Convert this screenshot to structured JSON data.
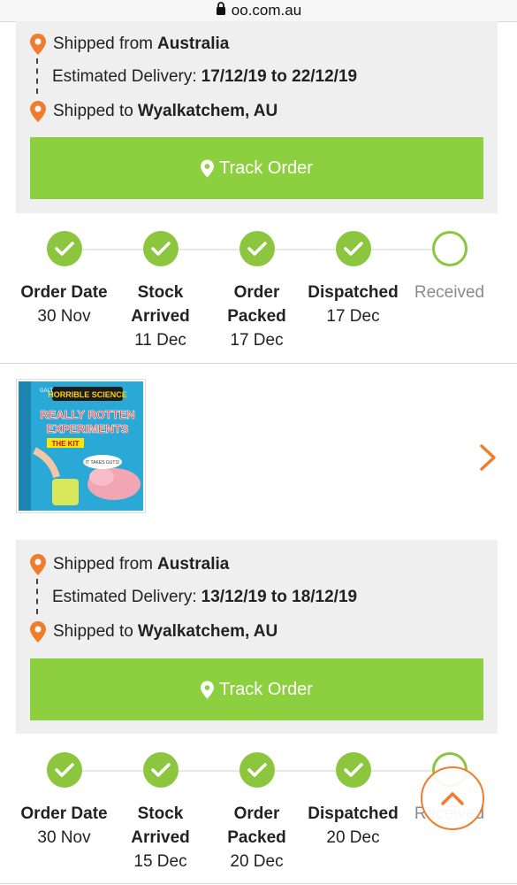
{
  "browser": {
    "url": "oo.com.au"
  },
  "orders": [
    {
      "shipped_from_label": "Shipped from",
      "shipped_from": "Australia",
      "delivery_label": "Estimated Delivery:",
      "delivery_range": "17/12/19 to 22/12/19",
      "shipped_to_label": "Shipped to",
      "shipped_to": "Wyalkatchem, AU",
      "track_label": "Track Order",
      "steps": [
        {
          "name": "Order Date",
          "date": "30 Nov",
          "done": true
        },
        {
          "name": "Stock Arrived",
          "date": "11 Dec",
          "done": true
        },
        {
          "name": "Order Packed",
          "date": "17 Dec",
          "done": true
        },
        {
          "name": "Dispatched",
          "date": "17 Dec",
          "done": true
        },
        {
          "name": "Received",
          "date": "",
          "done": false
        }
      ]
    },
    {
      "shipped_from_label": "Shipped from",
      "shipped_from": "Australia",
      "delivery_label": "Estimated Delivery:",
      "delivery_range": "13/12/19 to 18/12/19",
      "shipped_to_label": "Shipped to",
      "shipped_to": "Wyalkatchem, AU",
      "track_label": "Track Order",
      "steps": [
        {
          "name": "Order Date",
          "date": "30 Nov",
          "done": true
        },
        {
          "name": "Stock Arrived",
          "date": "15 Dec",
          "done": true
        },
        {
          "name": "Order Packed",
          "date": "20 Dec",
          "done": true
        },
        {
          "name": "Dispatched",
          "date": "20 Dec",
          "done": true
        },
        {
          "name": "Received",
          "date": "",
          "done": false
        }
      ]
    }
  ],
  "product": {
    "brand": "GALT",
    "series": "HORRIBLE SCIENCE",
    "title_line1": "REALLY ROTTEN",
    "title_line2": "EXPERIMENTS",
    "subtitle": "THE KIT",
    "bubble": "IT TAKES GUTS!"
  },
  "colors": {
    "accent_green": "#8dd03f",
    "step_green": "#8cc63f",
    "pin_orange": "#f07d2b",
    "panel_bg": "#efefef"
  },
  "icons": {
    "pin": "map-pin-icon",
    "check": "check-icon",
    "chevron": "chevron-right-icon",
    "scroll_top": "chevron-up-icon",
    "lock": "lock-icon"
  }
}
